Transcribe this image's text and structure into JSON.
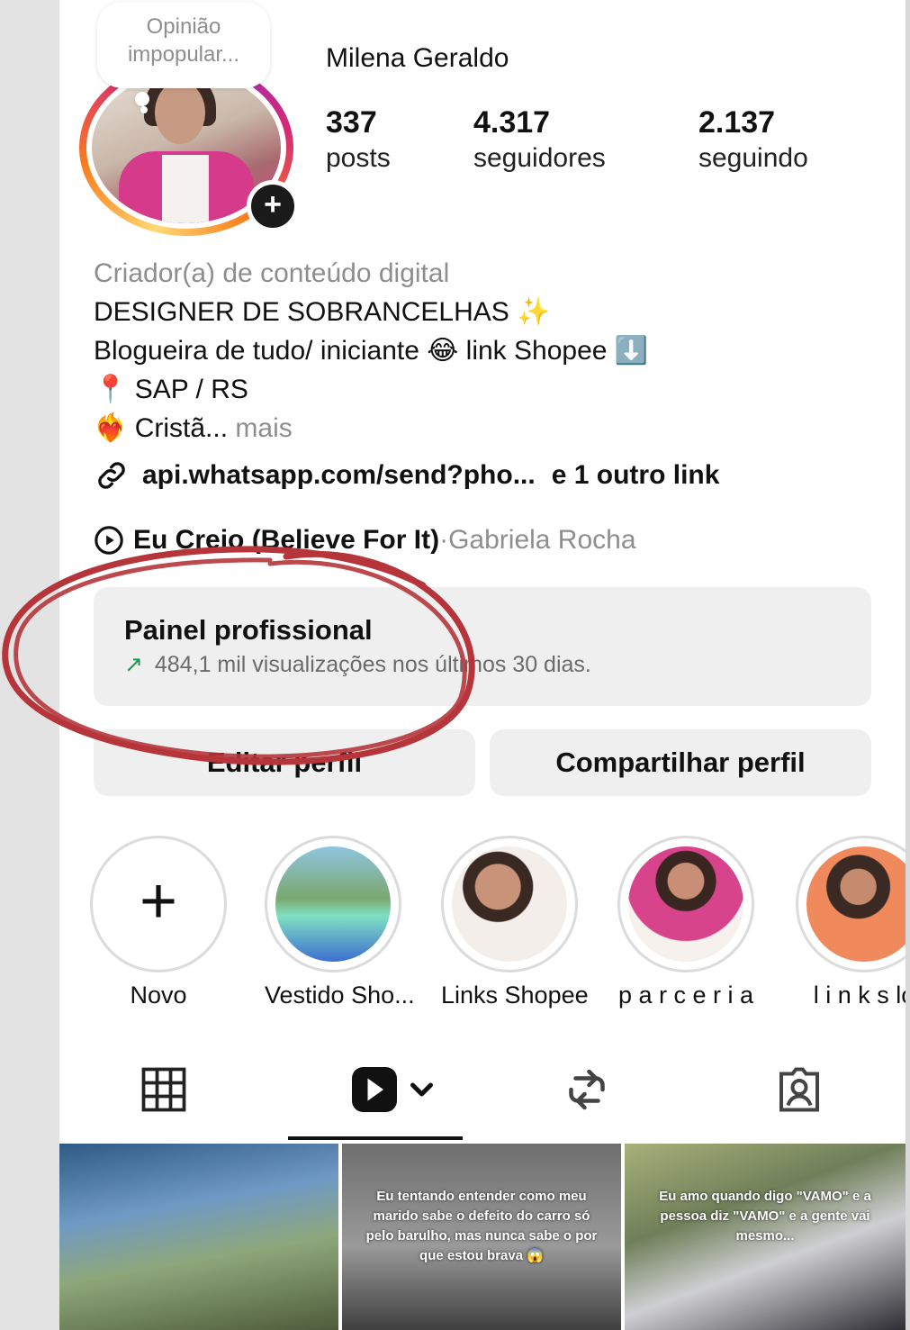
{
  "profile": {
    "note": "Opinião impopular...",
    "username": "Milena Geraldo",
    "stats": [
      {
        "value": "337",
        "label": "posts"
      },
      {
        "value": "4.317",
        "label": "seguidores"
      },
      {
        "value": "2.137",
        "label": "seguindo"
      }
    ]
  },
  "bio": {
    "category": "Criador(a) de conteúdo digital",
    "line1": "DESIGNER DE SOBRANCELHAS",
    "line1_emoji": "✨",
    "line2_a": "Blogueira de tudo/ iniciante",
    "line2_emoji": "😂",
    "line2_b": "link Shopee",
    "line2_emoji2": "⬇️",
    "line3_emoji": "📍",
    "line3": "SAP / RS",
    "line4_emoji": "❤️‍🔥",
    "line4": "Cristã...",
    "more": "mais"
  },
  "link": {
    "url": "api.whatsapp.com/send?pho...",
    "extra": "e 1 outro link"
  },
  "music": {
    "title": "Eu Creio (Believe For It)",
    "separator": " · ",
    "artist": "Gabriela Rocha"
  },
  "dashboard": {
    "title": "Painel profissional",
    "arrow": "↗",
    "subtitle": "484,1 mil visualizações nos últimos 30 dias."
  },
  "buttons": {
    "edit": "Editar perfil",
    "share": "Compartilhar perfil"
  },
  "highlights": [
    {
      "label": "Novo",
      "symbol": "+"
    },
    {
      "label": "Vestido Sho..."
    },
    {
      "label": "Links Shopee"
    },
    {
      "label": "p a r c e r i a"
    },
    {
      "label": "l i n k s lo"
    }
  ],
  "grid": [
    {
      "caption": ""
    },
    {
      "caption": "Eu tentando entender como meu marido sabe o defeito do carro só pelo barulho, mas nunca sabe o por que estou brava 😱"
    },
    {
      "caption": "Eu amo quando digo \"VAMO\" e a pessoa diz \"VAMO\" e a gente vai mesmo..."
    }
  ],
  "colors": {
    "annotation": "#b5353a",
    "growth": "#1a9a53",
    "muted": "#8e8e8e"
  }
}
